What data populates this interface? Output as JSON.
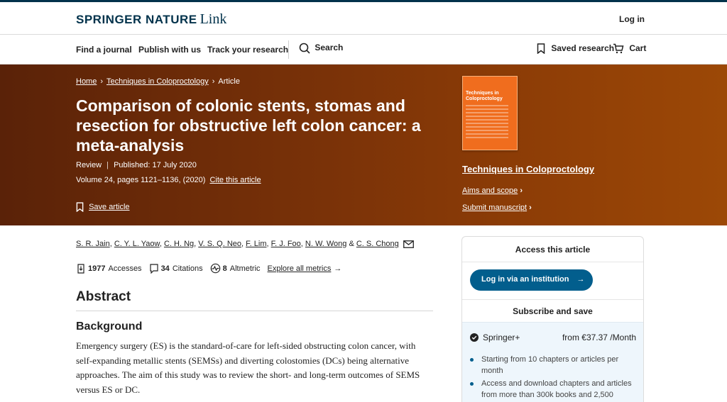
{
  "brand": {
    "name": "SPRINGER NATURE",
    "product": "Link"
  },
  "header": {
    "login": "Log in"
  },
  "nav": {
    "find_journal": "Find a journal",
    "publish": "Publish with us",
    "track": "Track your research",
    "search": "Search",
    "saved": "Saved research",
    "cart": "Cart"
  },
  "breadcrumb": {
    "home": "Home",
    "journal": "Techniques in Coloproctology",
    "current": "Article"
  },
  "article": {
    "title": "Comparison of colonic stents, stomas and resection for obstructive left colon cancer: a meta-analysis",
    "type": "Review",
    "published": "Published: 17 July 2020",
    "volume": "Volume 24, pages 1121–1136, (2020)",
    "cite": "Cite this article",
    "save": "Save article"
  },
  "journal": {
    "name": "Techniques in Coloproctology",
    "cover_title": "Techniques in Coloproctology",
    "aims": "Aims and scope",
    "submit": "Submit manuscript"
  },
  "authors": [
    "S. R. Jain",
    "C. Y. L. Yaow",
    "C. H. Ng",
    "V. S. Q. Neo",
    "F. Lim",
    "F. J. Foo",
    "N. W. Wong",
    "C. S. Chong"
  ],
  "metrics": {
    "accesses_count": "1977",
    "accesses_label": "Accesses",
    "citations_count": "34",
    "citations_label": "Citations",
    "altmetric_count": "8",
    "altmetric_label": "Altmetric",
    "explore": "Explore all metrics"
  },
  "abstract": {
    "heading": "Abstract",
    "background_heading": "Background",
    "background_text": "Emergency surgery (ES) is the standard-of-care for left-sided obstructing colon cancer, with self-expanding metallic stents (SEMSs) and diverting colostomies (DCs) being alternative approaches. The aim of this study was to review the short- and long-term outcomes of SEMS versus ES or DC."
  },
  "access": {
    "heading": "Access this article",
    "login_institution": "Log in via an institution",
    "subscribe_heading": "Subscribe and save",
    "plan_name": "Springer+",
    "plan_price": "from €37.37 /Month",
    "bullet1": "Starting from 10 chapters or articles per month",
    "bullet2": "Access and download chapters and articles from more than 300k books and 2,500"
  },
  "colors": {
    "hero_start": "#5a2208",
    "hero_end": "#9c4806",
    "primary": "#025e8d",
    "brand": "#01324b"
  }
}
